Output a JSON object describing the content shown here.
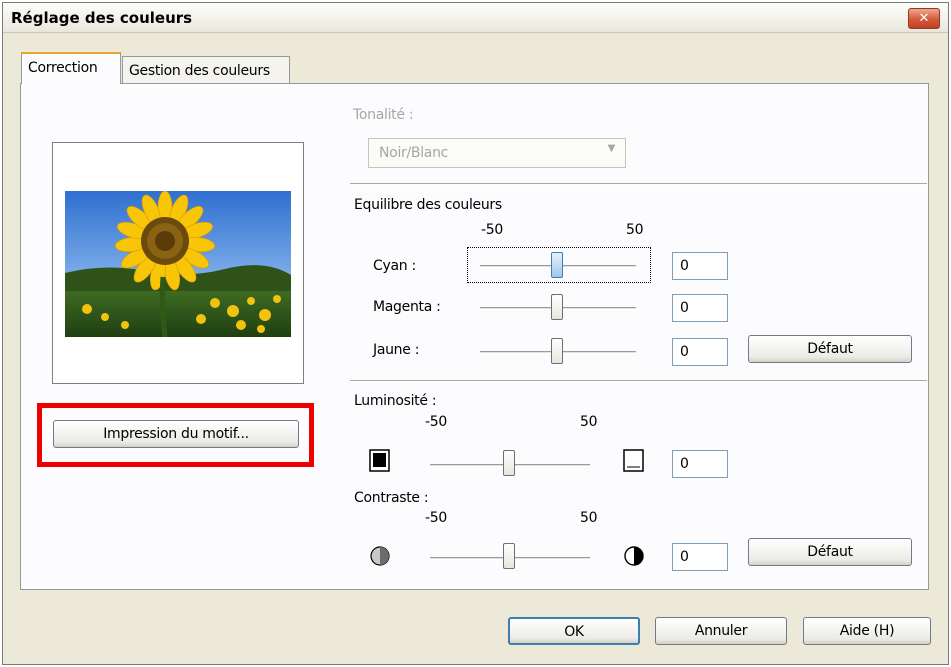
{
  "window": {
    "title": "Réglage des couleurs",
    "close_label": "✕"
  },
  "tabs": [
    {
      "label": "Correction",
      "active": true
    },
    {
      "label": "Gestion des couleurs",
      "active": false
    }
  ],
  "preview": {
    "button_label": "Impression du motif..."
  },
  "tonalite": {
    "label": "Tonalité :",
    "value": "Noir/Blanc",
    "enabled": false
  },
  "balance": {
    "label": "Equilibre des couleurs",
    "min_label": "-50",
    "max_label": "50",
    "sliders": [
      {
        "label": "Cyan :",
        "value": "0"
      },
      {
        "label": "Magenta :",
        "value": "0"
      },
      {
        "label": "Jaune :",
        "value": "0"
      }
    ],
    "default_label": "Défaut"
  },
  "brightness": {
    "label": "Luminosité :",
    "min_label": "-50",
    "max_label": "50",
    "value": "0"
  },
  "contrast": {
    "label": "Contraste :",
    "min_label": "-50",
    "max_label": "50",
    "value": "0",
    "default_label": "Défaut"
  },
  "footer": {
    "ok_label": "OK",
    "cancel_label": "Annuler",
    "help_label": "Aide (H)"
  },
  "colors": {
    "highlight": "#ee0000",
    "close_button": "#d4583b",
    "focus_thumb": "#9fc6ec"
  }
}
